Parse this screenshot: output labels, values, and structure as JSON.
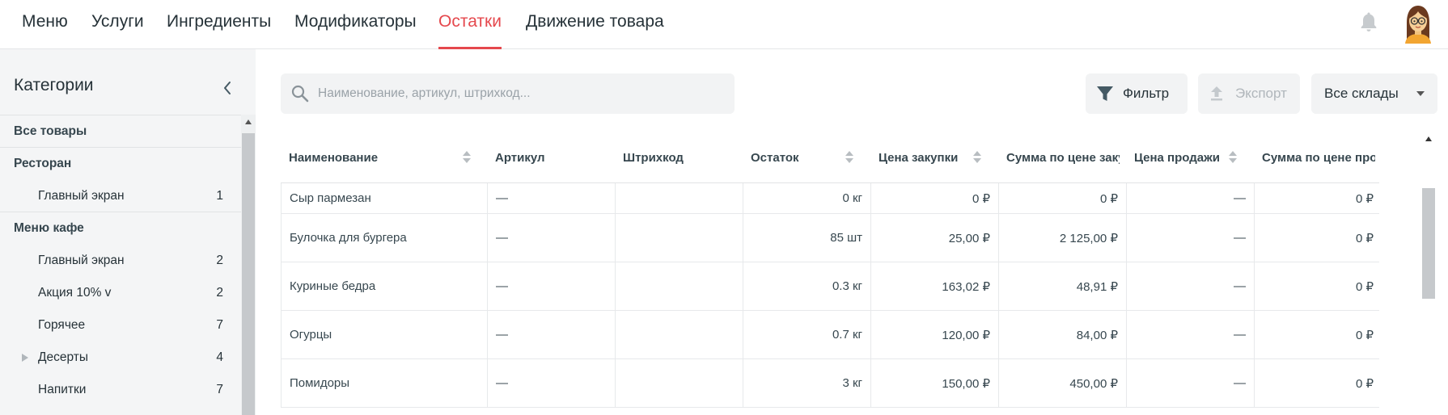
{
  "nav": {
    "tabs": [
      {
        "label": "Меню"
      },
      {
        "label": "Услуги"
      },
      {
        "label": "Ингредиенты"
      },
      {
        "label": "Модификаторы"
      },
      {
        "label": "Остатки",
        "active": true
      },
      {
        "label": "Движение товара"
      }
    ]
  },
  "sidebar": {
    "title": "Категории",
    "items": [
      {
        "label": "Все товары",
        "type": "group"
      },
      {
        "label": "Ресторан",
        "type": "group"
      },
      {
        "label": "Главный экран",
        "count": "1",
        "type": "sub"
      },
      {
        "label": "Меню кафе",
        "type": "group"
      },
      {
        "label": "Главный экран",
        "count": "2",
        "type": "sub"
      },
      {
        "label": "Акция 10% v",
        "count": "2",
        "type": "sub"
      },
      {
        "label": "Горячее",
        "count": "7",
        "type": "sub"
      },
      {
        "label": "Десерты",
        "count": "4",
        "type": "sub",
        "expandable": true
      },
      {
        "label": "Напитки",
        "count": "7",
        "type": "sub"
      }
    ]
  },
  "search": {
    "placeholder": "Наименование, артикул, штрихкод...",
    "value": ""
  },
  "toolbar": {
    "filter_label": "Фильтр",
    "export_label": "Экспорт",
    "warehouse_label": "Все склады"
  },
  "table": {
    "columns": [
      "Наименование",
      "Артикул",
      "Штрихкод",
      "Остаток",
      "Цена закупки",
      "Сумма по цене закупки",
      "Цена продажи",
      "Сумма по цене продажи"
    ],
    "rows": [
      [
        "Сыр пармезан",
        "—",
        "",
        "0 кг",
        "0 ₽",
        "0 ₽",
        "—",
        "0 ₽"
      ],
      [
        "Булочка для бургера",
        "—",
        "",
        "85 шт",
        "25,00 ₽",
        "2 125,00 ₽",
        "—",
        "0 ₽"
      ],
      [
        "Куриные бедра",
        "—",
        "",
        "0.3 кг",
        "163,02 ₽",
        "48,91 ₽",
        "—",
        "0 ₽"
      ],
      [
        "Огурцы",
        "—",
        "",
        "0.7 кг",
        "120,00 ₽",
        "84,00 ₽",
        "—",
        "0 ₽"
      ],
      [
        "Помидоры",
        "—",
        "",
        "3 кг",
        "150,00 ₽",
        "450,00 ₽",
        "—",
        "0 ₽"
      ]
    ]
  },
  "colors": {
    "accent": "#e5484d",
    "text": "#263238",
    "sidebar_bg": "#f4f5f6",
    "column_settings": "#1e6fd9"
  },
  "icons": {
    "bell": "bell-icon",
    "avatar": "user-avatar",
    "search": "search-icon",
    "filter": "filter-icon",
    "export": "upload-icon",
    "collapse": "chevron-left-icon",
    "columns": "columns-icon"
  }
}
